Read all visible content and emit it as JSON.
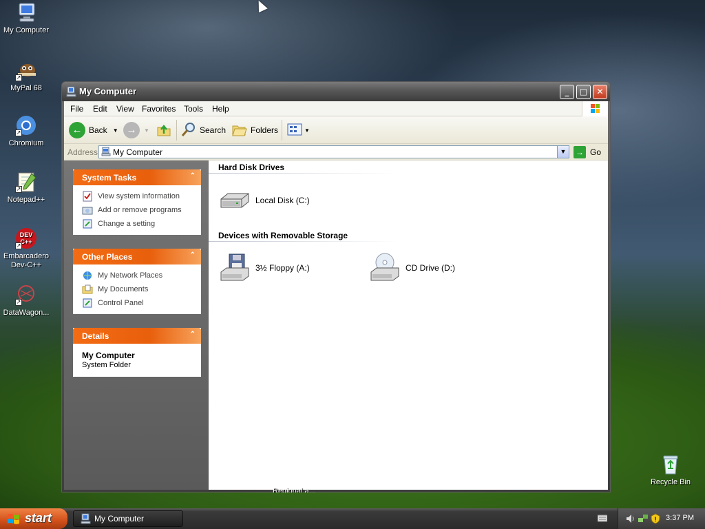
{
  "desktop": {
    "icons": [
      {
        "label": "My Computer"
      },
      {
        "label": "MyPal 68"
      },
      {
        "label": "Chromium"
      },
      {
        "label": "Notepad++"
      },
      {
        "label": "Embarcadero Dev-C++"
      },
      {
        "label": "DataWagon..."
      },
      {
        "label": "Recycle Bin"
      }
    ],
    "hidden_label": "Regional a..."
  },
  "window": {
    "title": "My Computer",
    "menu": [
      "File",
      "Edit",
      "View",
      "Favorites",
      "Tools",
      "Help"
    ],
    "toolbar": {
      "back_label": "Back",
      "search_label": "Search",
      "folders_label": "Folders"
    },
    "address": {
      "label": "Address",
      "value": "My Computer",
      "go_label": "Go"
    },
    "panels": {
      "system_tasks": {
        "title": "System Tasks",
        "items": [
          "View system information",
          "Add or remove programs",
          "Change a setting"
        ]
      },
      "other_places": {
        "title": "Other Places",
        "items": [
          "My Network Places",
          "My Documents",
          "Control Panel"
        ]
      },
      "details": {
        "title": "Details",
        "name": "My Computer",
        "type": "System Folder"
      }
    },
    "groups": {
      "hard_disks": {
        "title": "Hard Disk Drives",
        "items": [
          "Local Disk (C:)"
        ]
      },
      "removable": {
        "title": "Devices with Removable Storage",
        "items": [
          "3½ Floppy (A:)",
          "CD Drive (D:)"
        ]
      }
    }
  },
  "taskbar": {
    "start_label": "start",
    "task_label": "My Computer",
    "clock": "3:37 PM"
  },
  "colors": {
    "panel_header": "#f36c14",
    "window_frame": "#5a5a5a",
    "link_text": "#444444"
  }
}
